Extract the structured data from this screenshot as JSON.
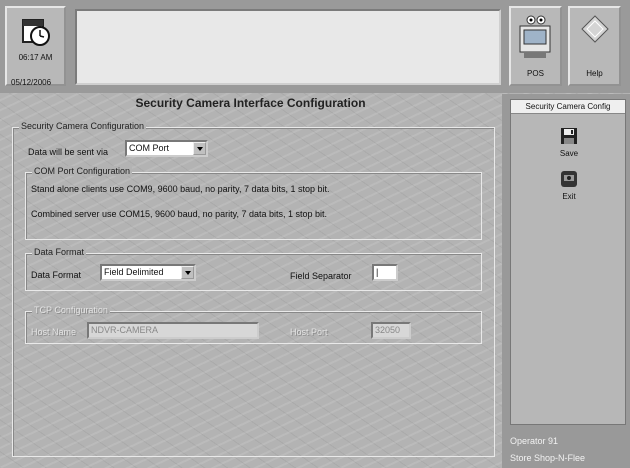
{
  "header": {
    "clock": {
      "time": "06:17 AM",
      "date": "05/12/2006"
    },
    "pos_label": "POS",
    "help_label": "Help"
  },
  "page": {
    "title": "Security Camera Interface Configuration",
    "security_group": {
      "legend": "Security Camera Configuration",
      "send_via_label": "Data will be sent via",
      "send_via_value": "COM Port"
    },
    "com_group": {
      "legend": "COM Port Configuration",
      "line1": "Stand alone clients use COM9, 9600 baud, no parity, 7 data bits, 1 stop bit.",
      "line2": "Combined server use COM15, 9600 baud, no parity, 7 data bits, 1 stop bit."
    },
    "data_format_group": {
      "legend": "Data Format",
      "format_label": "Data Format",
      "format_value": "Field Delimited",
      "separator_label": "Field Separator",
      "separator_value": "|"
    },
    "tcp_group": {
      "legend": "TCP Configuration",
      "host_name_label": "Host Name",
      "host_name_value": "NDVR-CAMERA",
      "host_port_label": "Host Port",
      "host_port_value": "32050"
    }
  },
  "sidebar": {
    "title": "Security Camera Config",
    "save_label": "Save",
    "exit_label": "Exit"
  },
  "status": {
    "operator": "Operator 91",
    "store": "Store Shop-N-Flee"
  }
}
